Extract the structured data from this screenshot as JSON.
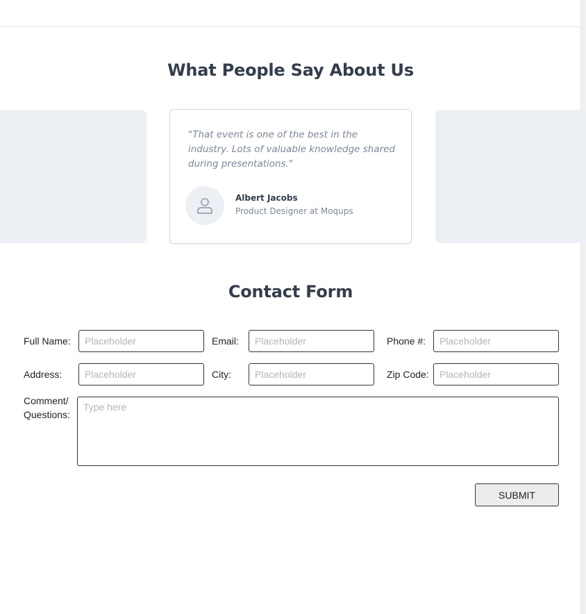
{
  "testimonials": {
    "title": "What People Say About Us",
    "featured": {
      "quote": "\"That event is one of the best in the industry. Lots of valuable knowledge shared during presentations.\"",
      "author_name": "Albert Jacobs",
      "author_role": "Product Designer at Moqups",
      "avatar_icon": "user-icon"
    }
  },
  "contact": {
    "title": "Contact Form",
    "labels": {
      "full_name": "Full Name:",
      "email": "Email:",
      "phone": "Phone #:",
      "address": "Address:",
      "city": "City:",
      "zip": "Zip Code:",
      "comment_line1": "Comment/",
      "comment_line2": "Questions:"
    },
    "placeholders": {
      "full_name": "Placeholder",
      "email": "Placeholder",
      "phone": "Placeholder",
      "address": "Placeholder",
      "city": "Placeholder",
      "zip": "Placeholder",
      "comment": "Type here"
    },
    "submit_label": "SUBMIT"
  }
}
